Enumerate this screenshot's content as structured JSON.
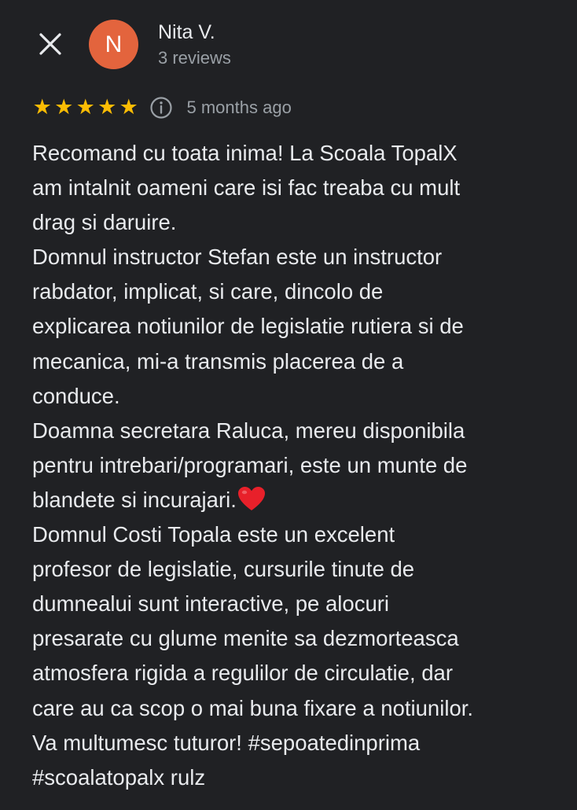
{
  "header": {
    "close_icon": "close-icon",
    "avatar_letter": "N",
    "avatar_color": "#e3643d",
    "author_name": "Nita V.",
    "review_count": "3 reviews"
  },
  "review": {
    "rating": 5,
    "max_rating": 5,
    "star_color": "#fbbc04",
    "info_icon": "info-icon",
    "time_ago": "5 months ago",
    "lines": [
      "Recomand cu toata inima! La Scoala TopalX",
      "am intalnit oameni care isi fac treaba cu mult",
      "drag si daruire.",
      "Domnul instructor Stefan este un instructor",
      "rabdator, implicat, si care, dincolo de",
      "explicarea notiunilor de legislatie rutiera si de",
      "mecanica, mi-a transmis placerea de a",
      "conduce.",
      "Doamna secretara Raluca, mereu disponibila",
      "pentru intrebari/programari, este un munte de",
      "blandete si incurajari.",
      "Domnul Costi Topala este un excelent",
      "profesor de legislatie, cursurile tinute de",
      "dumnealui sunt interactive, pe alocuri",
      "presarate cu glume menite sa dezmorteasca",
      "atmosfera rigida a regulilor de circulatie, dar",
      "care au ca scop o mai buna fixare a notiunilor.",
      "Va multumesc tuturor!  #sepoatedinprima",
      "#scoalatopalx rulz"
    ],
    "heart_emoji": "red-heart-emoji"
  }
}
